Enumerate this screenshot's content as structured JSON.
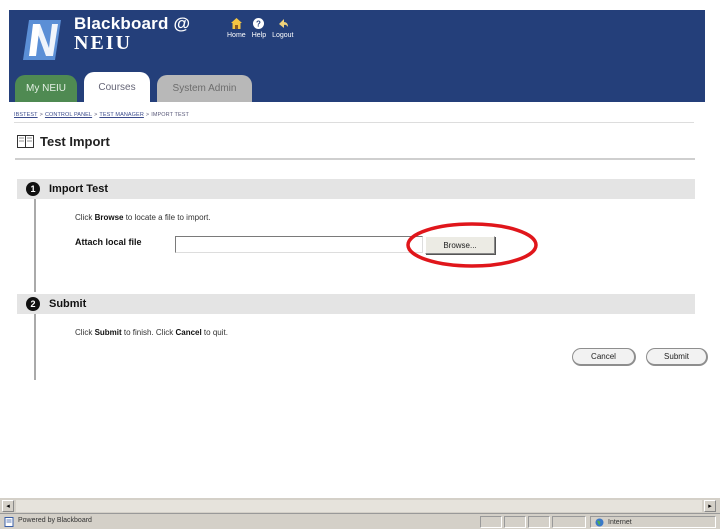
{
  "header": {
    "brand_line1": "Blackboard @",
    "brand_line2": "NEIU",
    "nav": [
      {
        "label": "Home",
        "icon": "home-icon"
      },
      {
        "label": "Help",
        "icon": "help-icon"
      },
      {
        "label": "Logout",
        "icon": "logout-icon"
      }
    ],
    "tabs": [
      "My NEIU",
      "Courses",
      "System Admin"
    ],
    "colors": {
      "bar": "#243f7a",
      "tab_active": "#ffffff",
      "tab_my": "#4f8a52",
      "tab_sysadmin": "#b8b8b8"
    }
  },
  "breadcrumb": {
    "items": [
      "IBSTEST",
      "CONTROL PANEL",
      "TEST MANAGER"
    ],
    "current": "IMPORT TEST",
    "separator": ">"
  },
  "page": {
    "title": "Test Import"
  },
  "step1": {
    "number": "1",
    "title": "Import Test",
    "instr_pre": "Click ",
    "instr_bold": "Browse",
    "instr_post": " to locate a file to import.",
    "file_label": "Attach local file",
    "file_value": "",
    "browse_label": "Browse..."
  },
  "step2": {
    "number": "2",
    "title": "Submit",
    "instr_pre": "Click ",
    "instr_bold1": "Submit",
    "instr_mid": " to finish. Click ",
    "instr_bold2": "Cancel",
    "instr_post": " to quit.",
    "cancel_label": "Cancel",
    "submit_label": "Submit"
  },
  "statusbar": {
    "text": "Powered by Blackboard",
    "zone": "Internet"
  },
  "highlight_color": "#e0161b"
}
